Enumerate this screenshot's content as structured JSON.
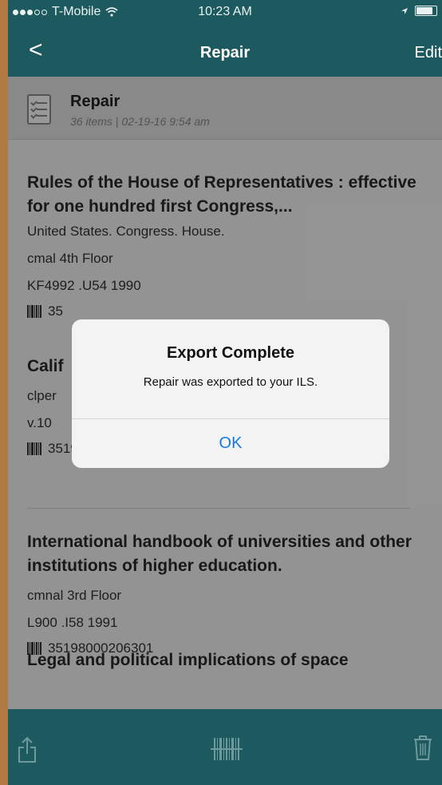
{
  "status_bar": {
    "carrier": "T-Mobile",
    "time": "10:23 AM"
  },
  "nav": {
    "back_glyph": "<",
    "title": "Repair",
    "edit_label": "Edit"
  },
  "list_header": {
    "title": "Repair",
    "subtitle": "36 items  |  02-19-16 9:54 am"
  },
  "items": [
    {
      "title": "Rules of the House of Representatives : effective for one hundred first Congress,...",
      "author": "United States. Congress. House.",
      "location": "cmal  4th Floor",
      "call_number": "KF4992 .U54 1990",
      "barcode": "35"
    },
    {
      "title": "Calif",
      "location": "clper",
      "call_number": "v.10",
      "barcode": "35198002939677"
    },
    {
      "title": "International handbook of universities and other institutions of higher education.",
      "location": "cmnal 3rd Floor",
      "call_number": "L900 .I58 1991",
      "barcode": "35198000206301"
    },
    {
      "title": "Legal and political implications of space"
    }
  ],
  "dialog": {
    "title": "Export Complete",
    "message": "Repair was exported to your ILS.",
    "ok_label": "OK"
  },
  "toolbar": {
    "icons": [
      "share-icon",
      "barcode-scan-icon",
      "trash-icon"
    ]
  },
  "colors": {
    "brand": "#1d5a5f",
    "dialog_button": "#1479e6"
  }
}
